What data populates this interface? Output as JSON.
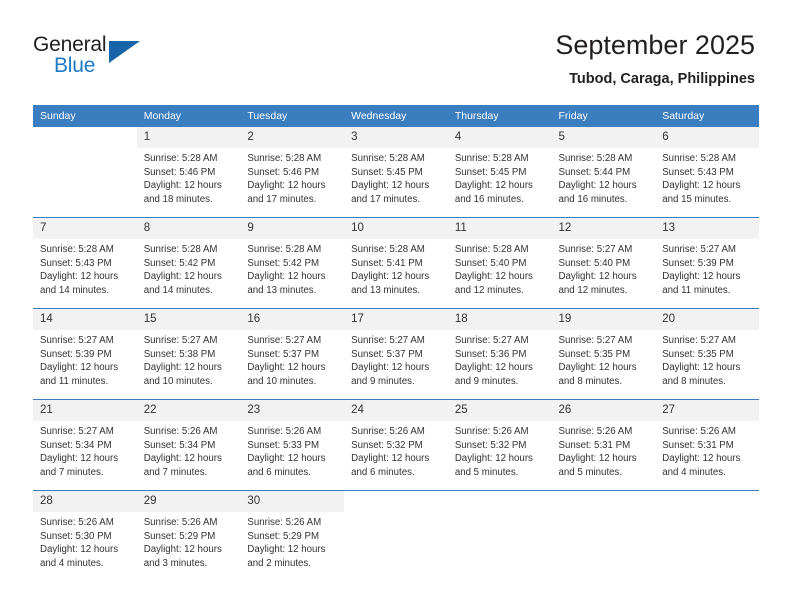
{
  "brand": {
    "name_part1": "General",
    "name_part2": "Blue",
    "accent_color": "#1f7ac4",
    "triangle_color": "#1765a8"
  },
  "header": {
    "title": "September 2025",
    "subtitle": "Tubod, Caraga, Philippines"
  },
  "calendar": {
    "header_color": "#3a7ebf",
    "daynum_band_color": "#f2f2f2",
    "weekday_headers": [
      "Sunday",
      "Monday",
      "Tuesday",
      "Wednesday",
      "Thursday",
      "Friday",
      "Saturday"
    ],
    "weeks": [
      [
        {
          "day": "",
          "blank": true,
          "sunrise": "",
          "sunset": "",
          "daylight_line1": "",
          "daylight_line2": ""
        },
        {
          "day": "1",
          "sunrise": "Sunrise: 5:28 AM",
          "sunset": "Sunset: 5:46 PM",
          "daylight_line1": "Daylight: 12 hours",
          "daylight_line2": "and 18 minutes."
        },
        {
          "day": "2",
          "sunrise": "Sunrise: 5:28 AM",
          "sunset": "Sunset: 5:46 PM",
          "daylight_line1": "Daylight: 12 hours",
          "daylight_line2": "and 17 minutes."
        },
        {
          "day": "3",
          "sunrise": "Sunrise: 5:28 AM",
          "sunset": "Sunset: 5:45 PM",
          "daylight_line1": "Daylight: 12 hours",
          "daylight_line2": "and 17 minutes."
        },
        {
          "day": "4",
          "sunrise": "Sunrise: 5:28 AM",
          "sunset": "Sunset: 5:45 PM",
          "daylight_line1": "Daylight: 12 hours",
          "daylight_line2": "and 16 minutes."
        },
        {
          "day": "5",
          "sunrise": "Sunrise: 5:28 AM",
          "sunset": "Sunset: 5:44 PM",
          "daylight_line1": "Daylight: 12 hours",
          "daylight_line2": "and 16 minutes."
        },
        {
          "day": "6",
          "sunrise": "Sunrise: 5:28 AM",
          "sunset": "Sunset: 5:43 PM",
          "daylight_line1": "Daylight: 12 hours",
          "daylight_line2": "and 15 minutes."
        }
      ],
      [
        {
          "day": "7",
          "sunrise": "Sunrise: 5:28 AM",
          "sunset": "Sunset: 5:43 PM",
          "daylight_line1": "Daylight: 12 hours",
          "daylight_line2": "and 14 minutes."
        },
        {
          "day": "8",
          "sunrise": "Sunrise: 5:28 AM",
          "sunset": "Sunset: 5:42 PM",
          "daylight_line1": "Daylight: 12 hours",
          "daylight_line2": "and 14 minutes."
        },
        {
          "day": "9",
          "sunrise": "Sunrise: 5:28 AM",
          "sunset": "Sunset: 5:42 PM",
          "daylight_line1": "Daylight: 12 hours",
          "daylight_line2": "and 13 minutes."
        },
        {
          "day": "10",
          "sunrise": "Sunrise: 5:28 AM",
          "sunset": "Sunset: 5:41 PM",
          "daylight_line1": "Daylight: 12 hours",
          "daylight_line2": "and 13 minutes."
        },
        {
          "day": "11",
          "sunrise": "Sunrise: 5:28 AM",
          "sunset": "Sunset: 5:40 PM",
          "daylight_line1": "Daylight: 12 hours",
          "daylight_line2": "and 12 minutes."
        },
        {
          "day": "12",
          "sunrise": "Sunrise: 5:27 AM",
          "sunset": "Sunset: 5:40 PM",
          "daylight_line1": "Daylight: 12 hours",
          "daylight_line2": "and 12 minutes."
        },
        {
          "day": "13",
          "sunrise": "Sunrise: 5:27 AM",
          "sunset": "Sunset: 5:39 PM",
          "daylight_line1": "Daylight: 12 hours",
          "daylight_line2": "and 11 minutes."
        }
      ],
      [
        {
          "day": "14",
          "sunrise": "Sunrise: 5:27 AM",
          "sunset": "Sunset: 5:39 PM",
          "daylight_line1": "Daylight: 12 hours",
          "daylight_line2": "and 11 minutes."
        },
        {
          "day": "15",
          "sunrise": "Sunrise: 5:27 AM",
          "sunset": "Sunset: 5:38 PM",
          "daylight_line1": "Daylight: 12 hours",
          "daylight_line2": "and 10 minutes."
        },
        {
          "day": "16",
          "sunrise": "Sunrise: 5:27 AM",
          "sunset": "Sunset: 5:37 PM",
          "daylight_line1": "Daylight: 12 hours",
          "daylight_line2": "and 10 minutes."
        },
        {
          "day": "17",
          "sunrise": "Sunrise: 5:27 AM",
          "sunset": "Sunset: 5:37 PM",
          "daylight_line1": "Daylight: 12 hours",
          "daylight_line2": "and 9 minutes."
        },
        {
          "day": "18",
          "sunrise": "Sunrise: 5:27 AM",
          "sunset": "Sunset: 5:36 PM",
          "daylight_line1": "Daylight: 12 hours",
          "daylight_line2": "and 9 minutes."
        },
        {
          "day": "19",
          "sunrise": "Sunrise: 5:27 AM",
          "sunset": "Sunset: 5:35 PM",
          "daylight_line1": "Daylight: 12 hours",
          "daylight_line2": "and 8 minutes."
        },
        {
          "day": "20",
          "sunrise": "Sunrise: 5:27 AM",
          "sunset": "Sunset: 5:35 PM",
          "daylight_line1": "Daylight: 12 hours",
          "daylight_line2": "and 8 minutes."
        }
      ],
      [
        {
          "day": "21",
          "sunrise": "Sunrise: 5:27 AM",
          "sunset": "Sunset: 5:34 PM",
          "daylight_line1": "Daylight: 12 hours",
          "daylight_line2": "and 7 minutes."
        },
        {
          "day": "22",
          "sunrise": "Sunrise: 5:26 AM",
          "sunset": "Sunset: 5:34 PM",
          "daylight_line1": "Daylight: 12 hours",
          "daylight_line2": "and 7 minutes."
        },
        {
          "day": "23",
          "sunrise": "Sunrise: 5:26 AM",
          "sunset": "Sunset: 5:33 PM",
          "daylight_line1": "Daylight: 12 hours",
          "daylight_line2": "and 6 minutes."
        },
        {
          "day": "24",
          "sunrise": "Sunrise: 5:26 AM",
          "sunset": "Sunset: 5:32 PM",
          "daylight_line1": "Daylight: 12 hours",
          "daylight_line2": "and 6 minutes."
        },
        {
          "day": "25",
          "sunrise": "Sunrise: 5:26 AM",
          "sunset": "Sunset: 5:32 PM",
          "daylight_line1": "Daylight: 12 hours",
          "daylight_line2": "and 5 minutes."
        },
        {
          "day": "26",
          "sunrise": "Sunrise: 5:26 AM",
          "sunset": "Sunset: 5:31 PM",
          "daylight_line1": "Daylight: 12 hours",
          "daylight_line2": "and 5 minutes."
        },
        {
          "day": "27",
          "sunrise": "Sunrise: 5:26 AM",
          "sunset": "Sunset: 5:31 PM",
          "daylight_line1": "Daylight: 12 hours",
          "daylight_line2": "and 4 minutes."
        }
      ],
      [
        {
          "day": "28",
          "sunrise": "Sunrise: 5:26 AM",
          "sunset": "Sunset: 5:30 PM",
          "daylight_line1": "Daylight: 12 hours",
          "daylight_line2": "and 4 minutes."
        },
        {
          "day": "29",
          "sunrise": "Sunrise: 5:26 AM",
          "sunset": "Sunset: 5:29 PM",
          "daylight_line1": "Daylight: 12 hours",
          "daylight_line2": "and 3 minutes."
        },
        {
          "day": "30",
          "sunrise": "Sunrise: 5:26 AM",
          "sunset": "Sunset: 5:29 PM",
          "daylight_line1": "Daylight: 12 hours",
          "daylight_line2": "and 2 minutes."
        },
        {
          "day": "",
          "blank": true,
          "sunrise": "",
          "sunset": "",
          "daylight_line1": "",
          "daylight_line2": ""
        },
        {
          "day": "",
          "blank": true,
          "sunrise": "",
          "sunset": "",
          "daylight_line1": "",
          "daylight_line2": ""
        },
        {
          "day": "",
          "blank": true,
          "sunrise": "",
          "sunset": "",
          "daylight_line1": "",
          "daylight_line2": ""
        },
        {
          "day": "",
          "blank": true,
          "sunrise": "",
          "sunset": "",
          "daylight_line1": "",
          "daylight_line2": ""
        }
      ]
    ]
  }
}
